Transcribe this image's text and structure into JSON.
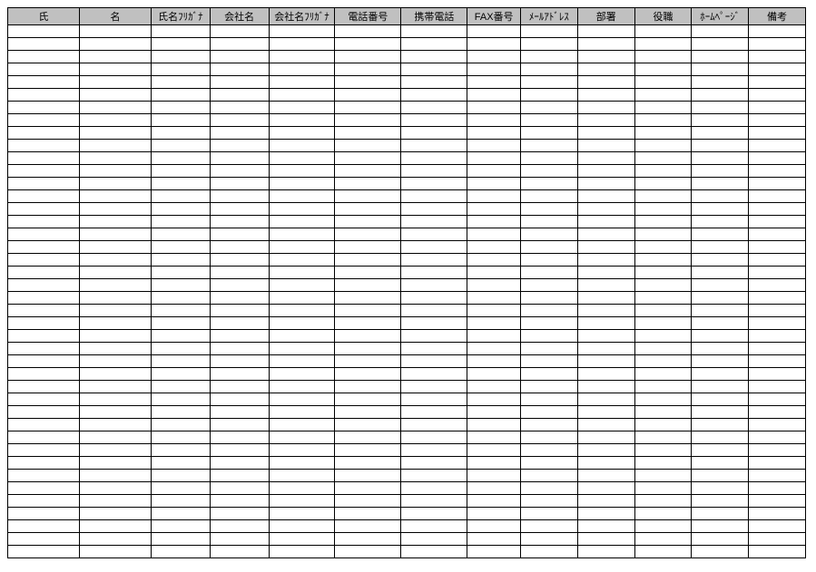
{
  "table": {
    "headers": [
      "氏",
      "名",
      "氏名ﾌﾘｶﾞﾅ",
      "会社名",
      "会社名ﾌﾘｶﾞﾅ",
      "電話番号",
      "携帯電話",
      "FAX番号",
      "ﾒｰﾙｱﾄﾞﾚｽ",
      "部署",
      "役職",
      "ﾎｰﾑﾍﾟｰｼﾞ",
      "備考"
    ],
    "row_count": 42
  }
}
